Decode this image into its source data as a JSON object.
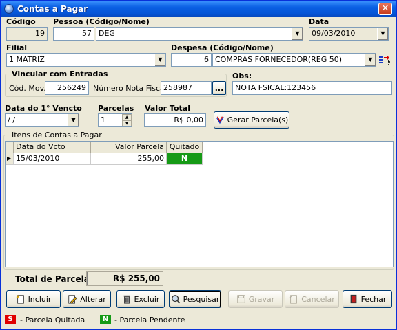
{
  "window": {
    "title": "Contas a Pagar",
    "close_symbol": "✕"
  },
  "codigo": {
    "label": "Código",
    "value": "19"
  },
  "pessoa": {
    "label": "Pessoa (Código/Nome)",
    "code": "57",
    "name": "DEG"
  },
  "data": {
    "label": "Data",
    "value": "09/03/2010"
  },
  "filial": {
    "label": "Filial",
    "value": "1 MATRIZ"
  },
  "despesa": {
    "label": "Despesa (Código/Nome)",
    "code": "6",
    "name": "COMPRAS FORNECEDOR(REG 50)"
  },
  "vincular": {
    "title": "Vincular com Entradas",
    "cod_mov_label": "Cód. Mov.",
    "cod_mov_value": "256249",
    "nota_label": "Número Nota Fiscal:",
    "nota_value": "258987",
    "browse_label": "..."
  },
  "obs": {
    "label": "Obs:",
    "value": "NOTA FSICAL:123456"
  },
  "vencto": {
    "label": "Data do 1° Vencto",
    "value": " / /"
  },
  "parcelas": {
    "label": "Parcelas",
    "value": "1"
  },
  "valor_total": {
    "label": "Valor Total",
    "value": "R$ 0,00"
  },
  "gerar_button": {
    "label": "Gerar Parcela(s)"
  },
  "itens": {
    "title": "Itens de Contas a Pagar",
    "columns": [
      "Data do Vcto",
      "Valor Parcela",
      "Quitado"
    ],
    "rows": [
      {
        "data": "15/03/2010",
        "valor": "255,00",
        "quitado": "N"
      }
    ]
  },
  "total_parcelas": {
    "label": "Total de Parcelas:",
    "value": "R$ 255,00"
  },
  "toolbar": {
    "incluir": "Incluir",
    "alterar": "Alterar",
    "excluir": "Excluir",
    "pesquisar": "Pesquisar",
    "gravar": "Gravar",
    "cancelar": "Cancelar",
    "fechar": "Fechar"
  },
  "legend": {
    "quitada_badge": "S",
    "quitada_text": "- Parcela Quitada",
    "pendente_badge": "N",
    "pendente_text": "- Parcela Pendente"
  },
  "colors": {
    "title_bar": "#0a5fe3",
    "pending_green": "#169a16",
    "paid_red": "#e00000",
    "window_bg": "#ece9d8"
  }
}
